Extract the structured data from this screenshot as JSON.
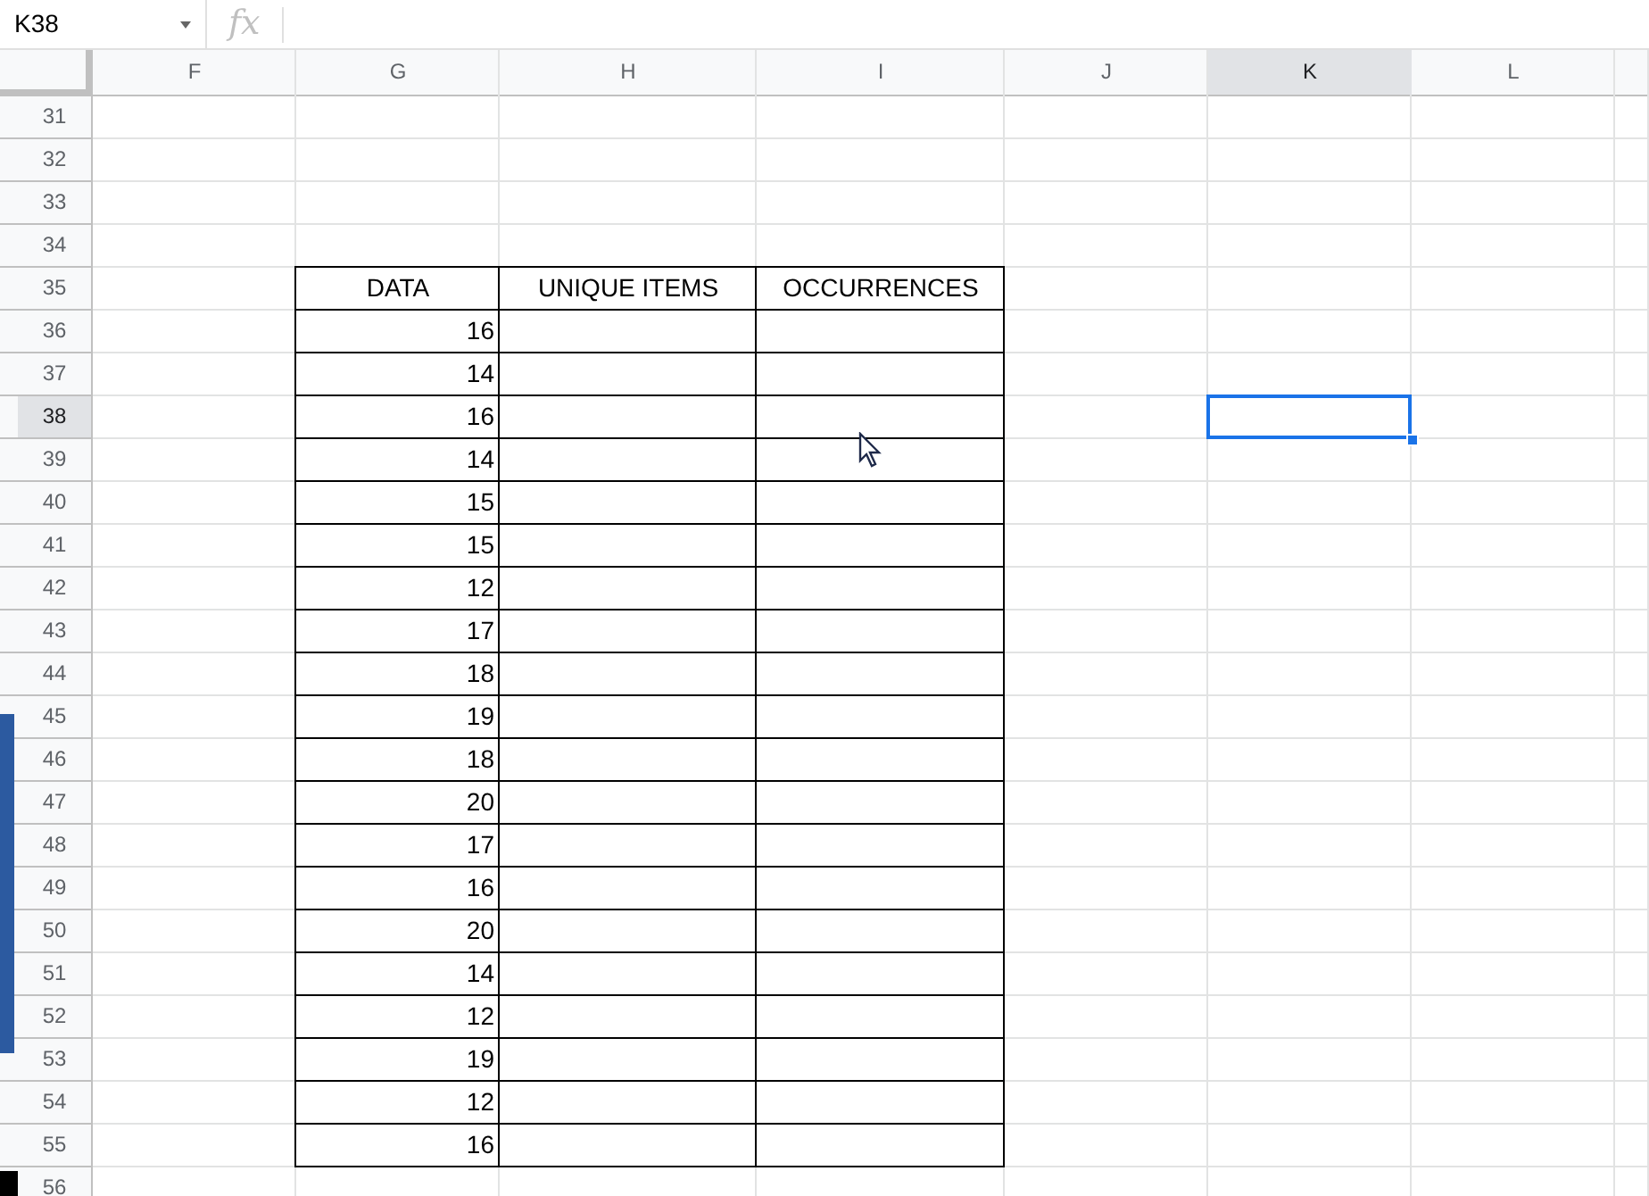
{
  "name_box": "K38",
  "formula_bar": {
    "label": "fx"
  },
  "columns": [
    {
      "label": "F",
      "selected": false
    },
    {
      "label": "G",
      "selected": false
    },
    {
      "label": "H",
      "selected": false
    },
    {
      "label": "I",
      "selected": false
    },
    {
      "label": "J",
      "selected": false
    },
    {
      "label": "K",
      "selected": true
    },
    {
      "label": "L",
      "selected": false
    }
  ],
  "table_borders": true,
  "rows": [
    {
      "label": "31",
      "selected": false
    },
    {
      "label": "32",
      "selected": false
    },
    {
      "label": "33",
      "selected": false
    },
    {
      "label": "34",
      "selected": false
    },
    {
      "label": "35",
      "selected": false,
      "cells": [
        {},
        {
          "text": "DATA",
          "kind": "heading"
        },
        {
          "text": "UNIQUE ITEMS",
          "kind": "heading"
        },
        {
          "text": "OCCURRENCES",
          "kind": "heading"
        }
      ]
    },
    {
      "label": "36",
      "selected": false,
      "cells": [
        {},
        {
          "text": "16",
          "kind": "number"
        }
      ]
    },
    {
      "label": "37",
      "selected": false,
      "cells": [
        {},
        {
          "text": "14",
          "kind": "number"
        }
      ]
    },
    {
      "label": "38",
      "selected": true,
      "cells": [
        {},
        {
          "text": "16",
          "kind": "number"
        },
        {},
        {},
        {},
        {
          "selected": true
        }
      ]
    },
    {
      "label": "39",
      "selected": false,
      "cells": [
        {},
        {
          "text": "14",
          "kind": "number"
        }
      ]
    },
    {
      "label": "40",
      "selected": false,
      "cells": [
        {},
        {
          "text": "15",
          "kind": "number"
        }
      ]
    },
    {
      "label": "41",
      "selected": false,
      "cells": [
        {},
        {
          "text": "15",
          "kind": "number"
        }
      ]
    },
    {
      "label": "42",
      "selected": false,
      "cells": [
        {},
        {
          "text": "12",
          "kind": "number"
        }
      ]
    },
    {
      "label": "43",
      "selected": false,
      "cells": [
        {},
        {
          "text": "17",
          "kind": "number"
        }
      ]
    },
    {
      "label": "44",
      "selected": false,
      "cells": [
        {},
        {
          "text": "18",
          "kind": "number"
        }
      ]
    },
    {
      "label": "45",
      "selected": false,
      "cells": [
        {},
        {
          "text": "19",
          "kind": "number"
        }
      ]
    },
    {
      "label": "46",
      "selected": false,
      "cells": [
        {},
        {
          "text": "18",
          "kind": "number"
        }
      ]
    },
    {
      "label": "47",
      "selected": false,
      "cells": [
        {},
        {
          "text": "20",
          "kind": "number"
        }
      ]
    },
    {
      "label": "48",
      "selected": false,
      "cells": [
        {},
        {
          "text": "17",
          "kind": "number"
        }
      ]
    },
    {
      "label": "49",
      "selected": false,
      "cells": [
        {},
        {
          "text": "16",
          "kind": "number"
        }
      ]
    },
    {
      "label": "50",
      "selected": false,
      "cells": [
        {},
        {
          "text": "20",
          "kind": "number"
        }
      ]
    },
    {
      "label": "51",
      "selected": false,
      "cells": [
        {},
        {
          "text": "14",
          "kind": "number"
        }
      ]
    },
    {
      "label": "52",
      "selected": false,
      "cells": [
        {},
        {
          "text": "12",
          "kind": "number"
        }
      ]
    },
    {
      "label": "53",
      "selected": false,
      "cells": [
        {},
        {
          "text": "19",
          "kind": "number"
        }
      ]
    },
    {
      "label": "54",
      "selected": false,
      "cells": [
        {},
        {
          "text": "12",
          "kind": "number"
        }
      ]
    },
    {
      "label": "55",
      "selected": false,
      "cells": [
        {},
        {
          "text": "16",
          "kind": "number"
        }
      ]
    },
    {
      "label": "56",
      "selected": false
    }
  ]
}
